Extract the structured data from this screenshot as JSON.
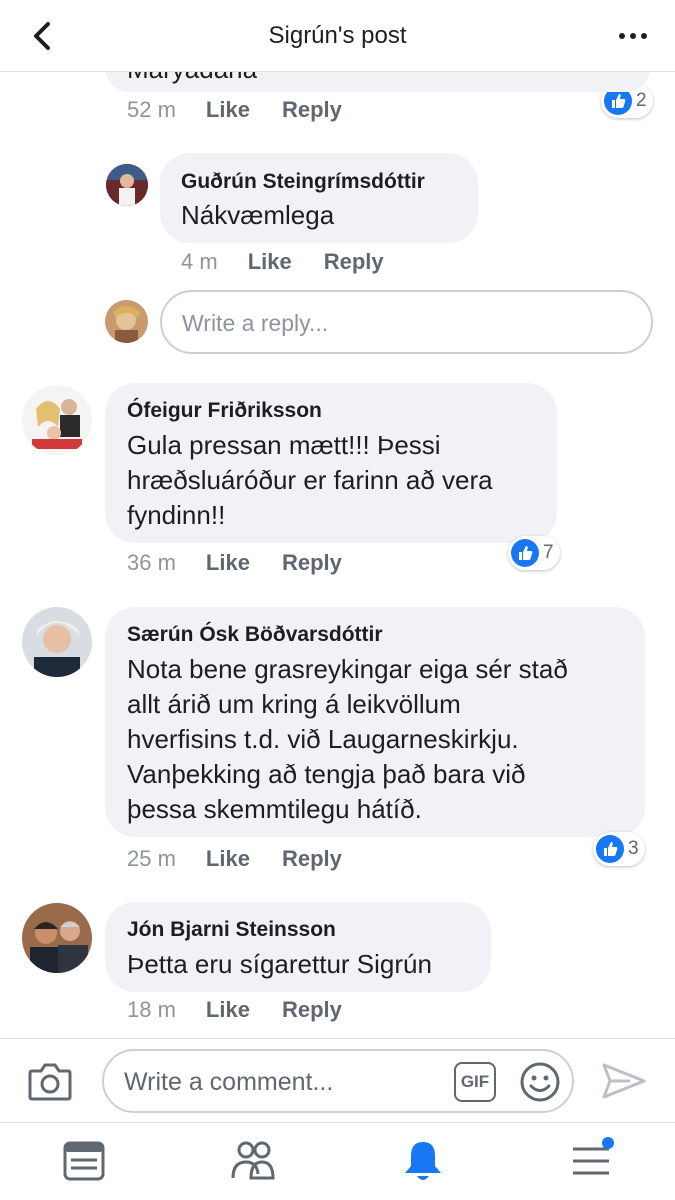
{
  "header": {
    "title": "Sigrún's post",
    "back_icon": "chevron-left-icon",
    "more_icon": "more-dots-icon"
  },
  "partial_comment": {
    "text_fragment": "Maryadana",
    "time": "52 m",
    "like_label": "Like",
    "reply_label": "Reply",
    "reaction_count": "2"
  },
  "reply": {
    "author": "Guðrún Steingrímsdóttir",
    "text": "Nákvæmlega",
    "time": "4 m",
    "like_label": "Like",
    "reply_label": "Reply"
  },
  "reply_input": {
    "placeholder": "Write a reply..."
  },
  "comments": [
    {
      "author": "Ófeigur Friðriksson",
      "lines": [
        "Gula pressan mætt!!!  Þessi",
        "hræðsluáróður er farinn að vera",
        "fyndinn!!"
      ],
      "time": "36 m",
      "like_label": "Like",
      "reply_label": "Reply",
      "reaction_count": "7"
    },
    {
      "author": "Særún Ósk Böðvarsdóttir",
      "lines": [
        "Nota bene grasreykingar eiga sér stað",
        "allt árið um kring á leikvöllum",
        "hverfisins t.d. við Laugarneskirkju.",
        "Vanþekking að tengja það bara við",
        "þessa skemmtilegu hátíð."
      ],
      "time": "25 m",
      "like_label": "Like",
      "reply_label": "Reply",
      "reaction_count": "3"
    },
    {
      "author": "Jón Bjarni Steinsson",
      "lines": [
        "Þetta eru sígarettur Sigrún"
      ],
      "time": "18 m",
      "like_label": "Like",
      "reply_label": "Reply"
    }
  ],
  "composer": {
    "placeholder": "Write a comment...",
    "gif_label": "GIF",
    "camera_icon": "camera-icon",
    "emoji_icon": "emoji-icon",
    "send_icon": "send-icon"
  },
  "tabbar": {
    "items": [
      "news-feed-icon",
      "friends-icon",
      "notifications-icon",
      "menu-icon"
    ],
    "active": "notifications-icon"
  },
  "colors": {
    "accent": "#1877f2",
    "bubble": "#f0f2f5",
    "muted_text": "#606770"
  }
}
